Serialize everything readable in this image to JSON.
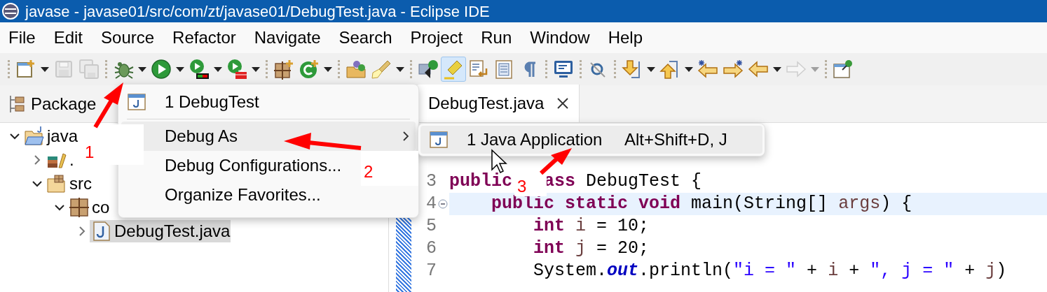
{
  "window": {
    "title": "javase - javase01/src/com/zt/javase01/DebugTest.java - Eclipse IDE"
  },
  "menu_bar": [
    "File",
    "Edit",
    "Source",
    "Refactor",
    "Navigate",
    "Search",
    "Project",
    "Run",
    "Window",
    "Help"
  ],
  "toolbar": {
    "groups": [
      [
        {
          "kind": "new",
          "disabled": false,
          "selected": false,
          "dropdown": true
        },
        {
          "kind": "save",
          "disabled": true,
          "selected": false,
          "dropdown": false
        },
        {
          "kind": "save_all",
          "disabled": true,
          "selected": false,
          "dropdown": false
        }
      ],
      [
        {
          "kind": "debug",
          "disabled": false,
          "selected": false,
          "dropdown": true
        },
        {
          "kind": "run",
          "disabled": false,
          "selected": false,
          "dropdown": true
        },
        {
          "kind": "coverage",
          "disabled": false,
          "selected": false,
          "dropdown": true
        },
        {
          "kind": "external",
          "disabled": false,
          "selected": false,
          "dropdown": true
        }
      ],
      [
        {
          "kind": "new_package",
          "disabled": false,
          "selected": false,
          "dropdown": false
        },
        {
          "kind": "new_class",
          "disabled": false,
          "selected": false,
          "dropdown": true
        }
      ],
      [
        {
          "kind": "open_type",
          "disabled": false,
          "selected": false,
          "dropdown": false
        },
        {
          "kind": "brush",
          "disabled": false,
          "selected": false,
          "dropdown": true
        }
      ],
      [
        {
          "kind": "task",
          "disabled": false,
          "selected": false,
          "dropdown": false
        },
        {
          "kind": "highlight",
          "disabled": false,
          "selected": true,
          "dropdown": false
        },
        {
          "kind": "block",
          "disabled": false,
          "selected": false,
          "dropdown": false
        },
        {
          "kind": "sheet",
          "disabled": false,
          "selected": false,
          "dropdown": false
        },
        {
          "kind": "pilcrow",
          "disabled": false,
          "selected": false,
          "dropdown": false
        }
      ],
      [
        {
          "kind": "monitor",
          "disabled": false,
          "selected": false,
          "dropdown": false
        }
      ],
      [
        {
          "kind": "search",
          "disabled": false,
          "selected": false,
          "dropdown": false
        }
      ],
      [
        {
          "kind": "next",
          "disabled": false,
          "selected": false,
          "dropdown": true
        },
        {
          "kind": "prev",
          "disabled": false,
          "selected": false,
          "dropdown": true
        },
        {
          "kind": "back_star",
          "disabled": false,
          "selected": false,
          "dropdown": false
        },
        {
          "kind": "forward_star",
          "disabled": false,
          "selected": false,
          "dropdown": false
        },
        {
          "kind": "back",
          "disabled": false,
          "selected": false,
          "dropdown": true
        },
        {
          "kind": "forward",
          "disabled": true,
          "selected": false,
          "dropdown": true
        }
      ],
      [
        {
          "kind": "pin",
          "disabled": false,
          "selected": false,
          "dropdown": false
        }
      ]
    ]
  },
  "package_explorer": {
    "tab": "Package",
    "tree": [
      {
        "label": "java",
        "kind": "project",
        "expanded": true,
        "selected": false,
        "children": [
          {
            "label": ".",
            "kind": "library",
            "expanded": false,
            "selected": false
          },
          {
            "label": "src",
            "kind": "source",
            "expanded": true,
            "selected": false,
            "children": [
              {
                "label": "co",
                "kind": "package",
                "expanded": true,
                "selected": false,
                "children": [
                  {
                    "label": "DebugTest.java",
                    "kind": "file",
                    "expanded": false,
                    "selected": true
                  }
                ]
              }
            ]
          }
        ]
      }
    ]
  },
  "editor": {
    "tab": "DebugTest.java",
    "lines": [
      {
        "number": "3",
        "current": false,
        "foldable": false,
        "segments": [
          [
            {
              "kind": "keyword",
              "text": "public"
            }
          ],
          [
            {
              "kind": "keyword",
              "text": "ass"
            },
            {
              "kind": "plain",
              "text": " DebugTest {"
            }
          ]
        ]
      },
      {
        "number": "4",
        "current": true,
        "foldable": true,
        "segments": [
          [
            {
              "kind": "keyword",
              "text": "    public"
            },
            {
              "kind": "keyword",
              "text": " static"
            },
            {
              "kind": "keyword",
              "text": " void"
            },
            {
              "kind": "plain",
              "text": " main(String[] "
            },
            {
              "kind": "local",
              "text": "args"
            },
            {
              "kind": "plain",
              "text": ") {"
            }
          ]
        ]
      },
      {
        "number": "5",
        "current": false,
        "foldable": false,
        "segments": [
          [
            {
              "kind": "keyword",
              "text": "        int"
            },
            {
              "kind": "local",
              "text": " i"
            },
            {
              "kind": "plain",
              "text": " = 10;"
            }
          ]
        ]
      },
      {
        "number": "6",
        "current": false,
        "foldable": false,
        "segments": [
          [
            {
              "kind": "keyword",
              "text": "        int"
            },
            {
              "kind": "local",
              "text": " j"
            },
            {
              "kind": "plain",
              "text": " = 20;"
            }
          ]
        ]
      },
      {
        "number": "7",
        "current": false,
        "foldable": false,
        "segments": [
          [
            {
              "kind": "plain",
              "text": "        System."
            },
            {
              "kind": "field",
              "text": "out"
            },
            {
              "kind": "plain",
              "text": ".println("
            },
            {
              "kind": "string",
              "text": "\"i = \""
            },
            {
              "kind": "plain",
              "text": " + "
            },
            {
              "kind": "local",
              "text": "i"
            },
            {
              "kind": "plain",
              "text": " + "
            },
            {
              "kind": "string",
              "text": "\", j = \""
            },
            {
              "kind": "plain",
              "text": " + "
            },
            {
              "kind": "local",
              "text": "j"
            },
            {
              "kind": "plain",
              "text": ")"
            }
          ]
        ]
      }
    ]
  },
  "context_menu": {
    "items": [
      {
        "label": "1 DebugTest",
        "kind": "launch",
        "selected": false,
        "submenu": false
      },
      {
        "label": "Debug As",
        "kind": "plain",
        "selected": true,
        "submenu": true
      },
      {
        "label": "Debug Configurations...",
        "kind": "plain",
        "selected": false,
        "submenu": false
      },
      {
        "label": "Organize Favorites...",
        "kind": "plain",
        "selected": false,
        "submenu": false
      }
    ]
  },
  "submenu": {
    "items": [
      {
        "label": "1 Java Application",
        "shortcut": "Alt+Shift+D, J",
        "selected": true
      }
    ]
  },
  "annotations": [
    {
      "label": "1"
    },
    {
      "label": "2"
    },
    {
      "label": "3"
    }
  ]
}
